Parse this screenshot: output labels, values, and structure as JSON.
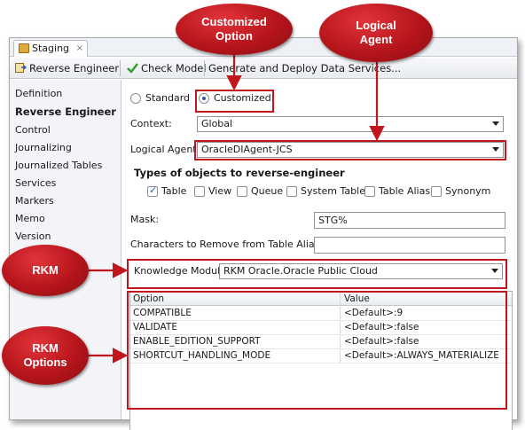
{
  "tab": {
    "label": "Staging",
    "close": "×"
  },
  "toolbar": {
    "reverse_engineer": "Reverse Engineer",
    "check_model": "Check Model",
    "generate_deploy": "Generate and Deploy Data Services..."
  },
  "nav": {
    "items": [
      {
        "label": "Definition"
      },
      {
        "label": "Reverse Engineer"
      },
      {
        "label": "Control"
      },
      {
        "label": "Journalizing"
      },
      {
        "label": "Journalized Tables"
      },
      {
        "label": "Services"
      },
      {
        "label": "Markers"
      },
      {
        "label": "Memo"
      },
      {
        "label": "Version"
      }
    ],
    "active_index": 1
  },
  "form": {
    "mode": {
      "standard": "Standard",
      "customized": "Customized",
      "selected": "customized"
    },
    "context_label": "Context:",
    "context_value": "Global",
    "logical_agent_label": "Logical Agent:",
    "logical_agent_value": "OracleDIAgent-JCS",
    "types_heading": "Types of objects to reverse-engineer",
    "types": [
      {
        "label": "Table",
        "checked": true
      },
      {
        "label": "View",
        "checked": false
      },
      {
        "label": "Queue",
        "checked": false
      },
      {
        "label": "System Table",
        "checked": false
      },
      {
        "label": "Table Alias",
        "checked": false
      },
      {
        "label": "Synonym",
        "checked": false
      }
    ],
    "mask_label": "Mask:",
    "mask_value": "STG%",
    "chars_remove_label": "Characters to Remove from Table Alias:",
    "chars_remove_value": "",
    "km_label": "Knowledge Module:",
    "km_value": "RKM Oracle.Oracle Public Cloud"
  },
  "options_table": {
    "columns": [
      "Option",
      "Value"
    ],
    "rows": [
      [
        "COMPATIBLE",
        "<Default>:9"
      ],
      [
        "VALIDATE",
        "<Default>:false"
      ],
      [
        "ENABLE_EDITION_SUPPORT",
        "<Default>:false"
      ],
      [
        "SHORTCUT_HANDLING_MODE",
        "<Default>:ALWAYS_MATERIALIZE"
      ]
    ]
  },
  "callouts": {
    "customized_option": [
      "Customized",
      "Option"
    ],
    "logical_agent": [
      "Logical",
      "Agent"
    ],
    "rkm": [
      "RKM"
    ],
    "rkm_options": [
      "RKM",
      "Options"
    ]
  },
  "colors": {
    "annotation_red": "#c0161d",
    "check_green": "#2e9b2e",
    "link_blue": "#2a5db0"
  }
}
